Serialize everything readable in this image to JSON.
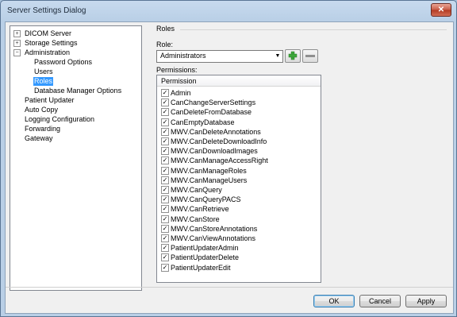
{
  "window": {
    "title": "Server Settings Dialog",
    "close_glyph": "✕"
  },
  "tree": {
    "items": [
      {
        "label": "DICOM Server",
        "expander": "+"
      },
      {
        "label": "Storage Settings",
        "expander": "+"
      },
      {
        "label": "Administration",
        "expander": "−"
      },
      {
        "label": "Password Options"
      },
      {
        "label": "Users"
      },
      {
        "label": "Roles",
        "selected": true
      },
      {
        "label": "Database Manager Options"
      },
      {
        "label": "Patient Updater"
      },
      {
        "label": "Auto Copy"
      },
      {
        "label": "Logging Configuration"
      },
      {
        "label": "Forwarding"
      },
      {
        "label": "Gateway"
      }
    ]
  },
  "roles": {
    "section_title": "Roles",
    "role_label": "Role:",
    "role_value": "Administrators",
    "dropdown_arrow": "▼",
    "permissions_label": "Permissions:",
    "permission_header": "Permission",
    "check_glyph": "✓",
    "permissions": [
      {
        "name": "Admin",
        "checked": true
      },
      {
        "name": "CanChangeServerSettings",
        "checked": true
      },
      {
        "name": "CanDeleteFromDatabase",
        "checked": true
      },
      {
        "name": "CanEmptyDatabase",
        "checked": true
      },
      {
        "name": "MWV.CanDeleteAnnotations",
        "checked": true
      },
      {
        "name": "MWV.CanDeleteDownloadInfo",
        "checked": true
      },
      {
        "name": "MWV.CanDownloadImages",
        "checked": true
      },
      {
        "name": "MWV.CanManageAccessRight",
        "checked": true
      },
      {
        "name": "MWV.CanManageRoles",
        "checked": true
      },
      {
        "name": "MWV.CanManageUsers",
        "checked": true
      },
      {
        "name": "MWV.CanQuery",
        "checked": true
      },
      {
        "name": "MWV.CanQueryPACS",
        "checked": true
      },
      {
        "name": "MWV.CanRetrieve",
        "checked": true
      },
      {
        "name": "MWV.CanStore",
        "checked": true
      },
      {
        "name": "MWV.CanStoreAnnotations",
        "checked": true
      },
      {
        "name": "MWV.CanViewAnnotations",
        "checked": true
      },
      {
        "name": "PatientUpdaterAdmin",
        "checked": true
      },
      {
        "name": "PatientUpdaterDelete",
        "checked": true
      },
      {
        "name": "PatientUpdaterEdit",
        "checked": true
      }
    ]
  },
  "buttons": {
    "ok": "OK",
    "cancel": "Cancel",
    "apply": "Apply"
  },
  "colors": {
    "selection": "#3399ff",
    "add_icon": "#3da83a"
  }
}
